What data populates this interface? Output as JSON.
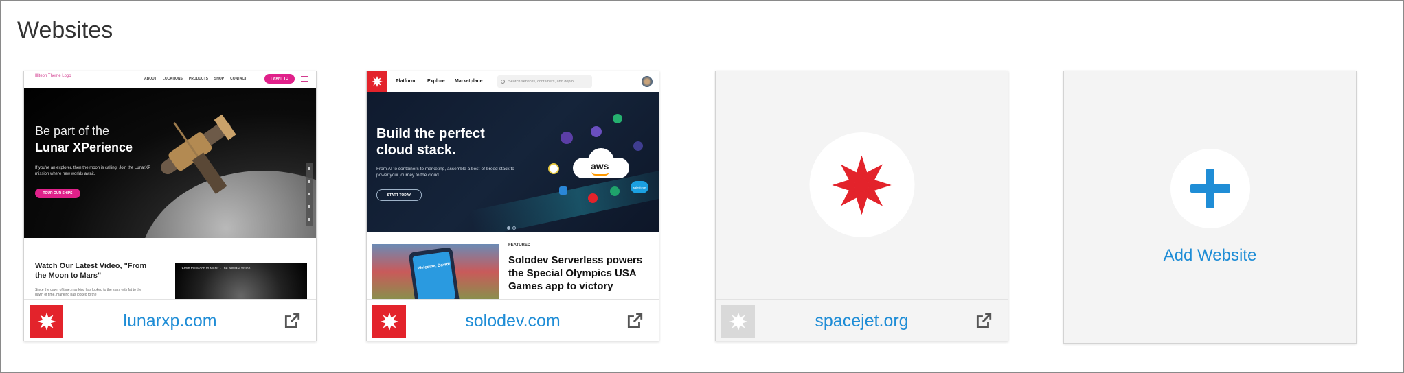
{
  "page": {
    "title": "Websites"
  },
  "colors": {
    "brand_red": "#e3232b",
    "link_blue": "#1f8dd6",
    "muted_gray": "#d9d9d9"
  },
  "sites": [
    {
      "domain": "lunarxp.com",
      "preview": {
        "logo_alt": "Illiteon Theme Logo",
        "nav": [
          "ABOUT",
          "LOCATIONS",
          "PRODUCTS",
          "SHOP",
          "CONTACT"
        ],
        "nav_button": "I WANT TO",
        "hero_line1": "Be part of the",
        "hero_line2": "Lunar XPerience",
        "hero_body": "If you're an explorer, then the moon is calling. Join the LunarXP mission where new worlds await.",
        "hero_button": "TOUR OUR SHIPS",
        "section_title": "Watch Our Latest Video, \"From the Moon to Mars\"",
        "section_body": "Since the dawn of time, mankind has looked to the stars with fat to the dawn of time, mankind has looked to the",
        "video_title": "\"From the Moon to Mars\" - The NewXP Vision"
      }
    },
    {
      "domain": "solodev.com",
      "preview": {
        "nav": [
          "Platform",
          "Explore",
          "Marketplace"
        ],
        "search_placeholder": "Search services, containers, and deplo",
        "hero_line1": "Build the perfect",
        "hero_line2": "cloud stack.",
        "hero_body": "From AI to containers to marketing, assemble a best-of-breed stack to power your journey to the cloud.",
        "hero_button": "START TODAY",
        "cloud_label": "aws",
        "badge_salesforce": "salesforce",
        "featured_tag": "FEATURED",
        "featured_title": "Solodev Serverless powers the Special Olympics USA Games app to victory",
        "phone_text": "Welcome, David!"
      }
    },
    {
      "domain": "spacejet.org"
    }
  ],
  "add_card": {
    "label": "Add Website"
  },
  "icons": {
    "external_link": "external-link-icon",
    "brand_logo": "solodev-star-logo-icon",
    "plus": "plus-icon"
  }
}
